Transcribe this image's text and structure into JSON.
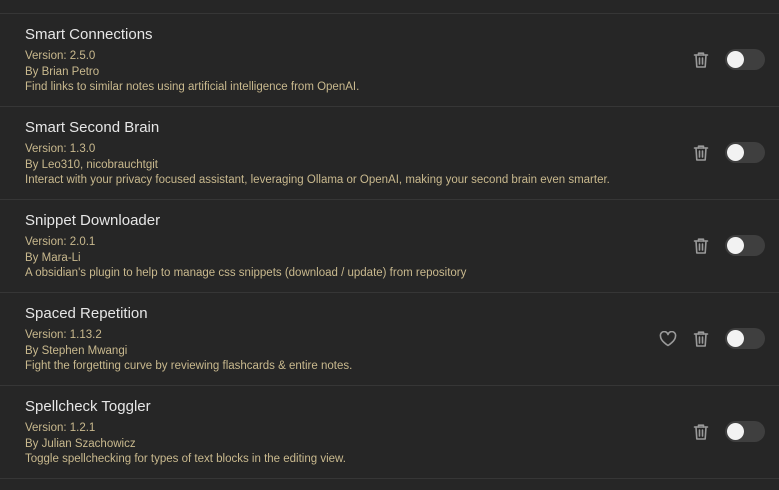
{
  "plugins": [
    {
      "name": "Smart Connections",
      "version": "Version: 2.5.0",
      "author": "By Brian Petro",
      "description": "Find links to similar notes using artificial intelligence from OpenAI.",
      "has_heart": false,
      "enabled": false
    },
    {
      "name": "Smart Second Brain",
      "version": "Version: 1.3.0",
      "author": "By Leo310, nicobrauchtgit",
      "description": "Interact with your privacy focused assistant, leveraging Ollama or OpenAI, making your second brain even smarter.",
      "has_heart": false,
      "enabled": false
    },
    {
      "name": "Snippet Downloader",
      "version": "Version: 2.0.1",
      "author": "By Mara-Li",
      "description": "A obsidian's plugin to help to manage css snippets (download / update) from repository",
      "has_heart": false,
      "enabled": false
    },
    {
      "name": "Spaced Repetition",
      "version": "Version: 1.13.2",
      "author": "By Stephen Mwangi",
      "description": "Fight the forgetting curve by reviewing flashcards & entire notes.",
      "has_heart": true,
      "enabled": false
    },
    {
      "name": "Spellcheck Toggler",
      "version": "Version: 1.2.1",
      "author": "By Julian Szachowicz",
      "description": "Toggle spellchecking for types of text blocks in the editing view.",
      "has_heart": false,
      "enabled": false
    }
  ],
  "icons": {
    "delete": "trash-icon",
    "donate": "heart-icon"
  },
  "colors": {
    "background": "#262626",
    "name_text": "#e6e6e6",
    "meta_text": "#c9b98e",
    "toggle_off_track": "#3f3f3f",
    "toggle_knob": "#f2f2f2",
    "divider": "#363636"
  }
}
